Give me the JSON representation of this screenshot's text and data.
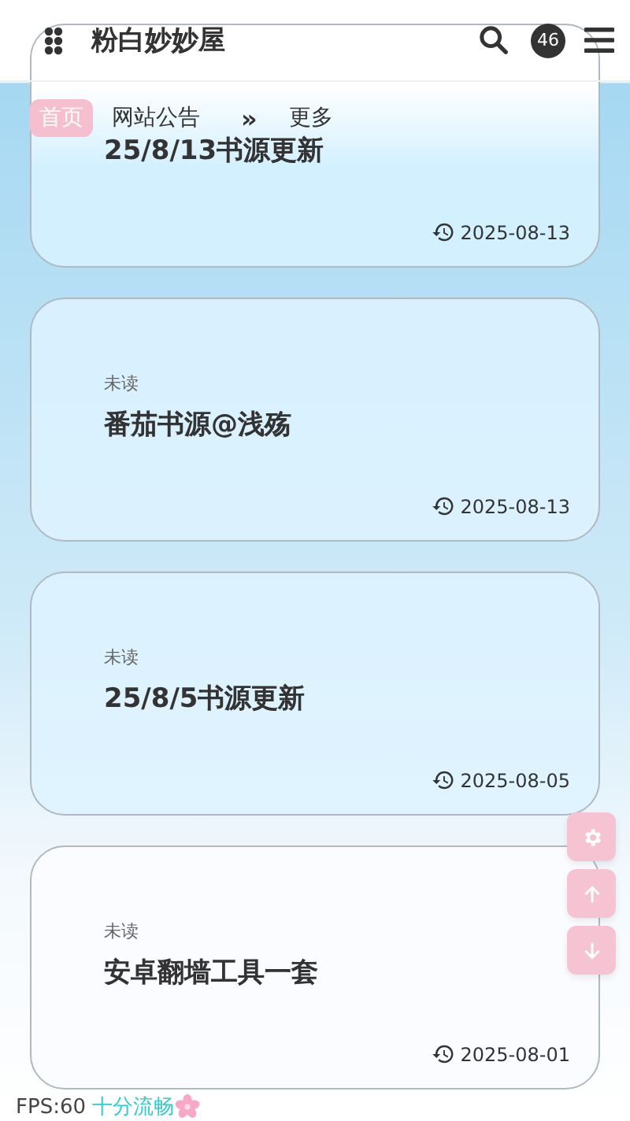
{
  "header": {
    "title": "粉白妙妙屋",
    "badge": "46"
  },
  "nav": {
    "home": "首页",
    "section": "网站公告",
    "arrow": "»",
    "more": "更多"
  },
  "posts": [
    {
      "title": "25/8/13书源更新",
      "date": "2025-08-13"
    },
    {
      "tag": "未读",
      "title": "番茄书源@浅殇",
      "date": "2025-08-13"
    },
    {
      "tag": "未读",
      "title": "25/8/5书源更新",
      "date": "2025-08-05"
    },
    {
      "tag": "未读",
      "title": "安卓翻墙工具一套",
      "date": "2025-08-01"
    }
  ],
  "fps": {
    "label": "FPS:60",
    "status": "十分流畅"
  }
}
